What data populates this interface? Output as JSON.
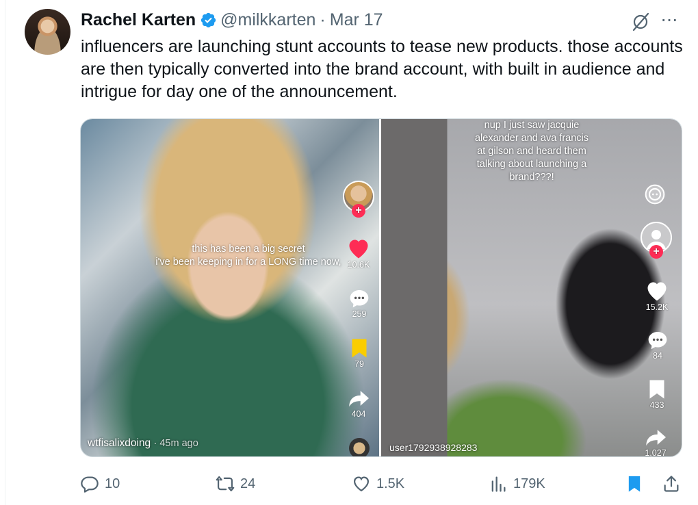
{
  "author": {
    "name": "Rachel Karten",
    "handle": "@milkkarten",
    "separator": "·",
    "date": "Mar 17"
  },
  "tweet": {
    "text": "influencers are launching stunt accounts to tease new products. those accounts are then typically converted into the brand account, with built in audience and intrigue for day one of the announcement."
  },
  "media": {
    "left": {
      "caption_line1": "this has been a big secret",
      "caption_line2": "i've been keeping in for a LONG time now,",
      "likes": "10.6K",
      "comments": "259",
      "saves": "79",
      "shares": "404",
      "username": "wtfisalixdoing",
      "time": "· 45m ago"
    },
    "right": {
      "caption_lines": [
        "nup I just saw jacquie",
        "alexander and ava francis",
        "at gilson and heard them",
        "talking about launching a",
        "brand???!"
      ],
      "likes": "15.2K",
      "comments": "84",
      "saves": "433",
      "shares": "1,027",
      "username": "user1792938928283"
    }
  },
  "actions": {
    "replies": "10",
    "reposts": "24",
    "likes": "1.5K",
    "views": "179K"
  },
  "colors": {
    "accent": "#1d9bf0",
    "muted": "#536471",
    "tiktok_red": "#fe2c55",
    "save_yellow": "#facd00"
  },
  "icons": [
    "verified-icon",
    "grok-icon",
    "more-icon",
    "reply-icon",
    "repost-icon",
    "like-icon",
    "views-icon",
    "bookmark-icon",
    "share-icon"
  ]
}
